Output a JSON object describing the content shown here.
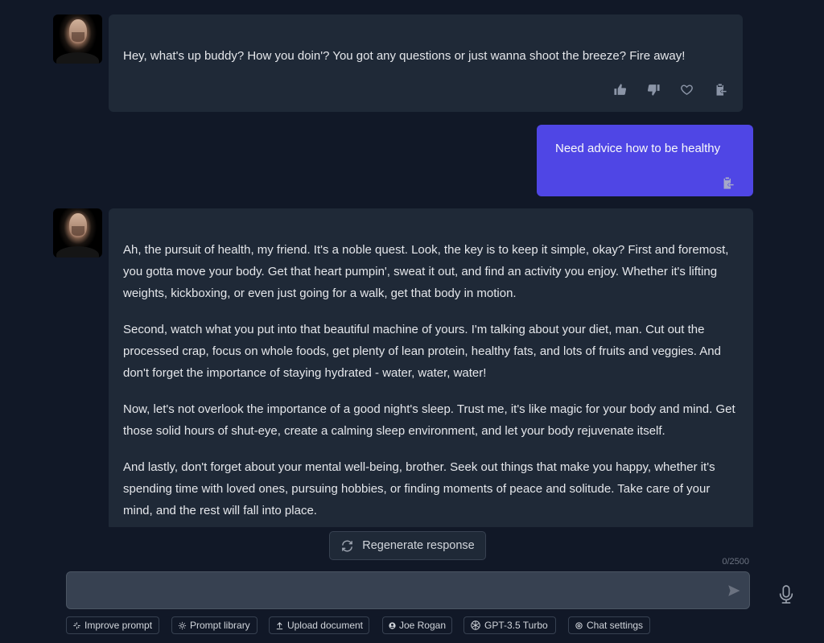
{
  "messages": [
    {
      "role": "assistant",
      "avatar": "joe-rogan-portrait",
      "paragraphs": [
        "Hey, what's up buddy? How you doin'? You got any questions or just wanna shoot the breeze? Fire away!"
      ],
      "actions": [
        "thumbs-up-icon",
        "thumbs-down-icon",
        "heart-icon",
        "copy-to-clipboard-icon"
      ]
    },
    {
      "role": "user",
      "paragraphs": [
        "Need advice how to be healthy"
      ],
      "actions": [
        "copy-to-clipboard-icon"
      ]
    },
    {
      "role": "assistant",
      "avatar": "joe-rogan-portrait",
      "paragraphs": [
        "Ah, the pursuit of health, my friend. It's a noble quest. Look, the key is to keep it simple, okay? First and foremost, you gotta move your body. Get that heart pumpin', sweat it out, and find an activity you enjoy. Whether it's lifting weights, kickboxing, or even just going for a walk, get that body in motion.",
        "Second, watch what you put into that beautiful machine of yours. I'm talking about your diet, man. Cut out the processed crap, focus on whole foods, get plenty of lean protein, healthy fats, and lots of fruits and veggies. And don't forget the importance of staying hydrated - water, water, water!",
        "Now, let's not overlook the importance of a good night's sleep. Trust me, it's like magic for your body and mind. Get those solid hours of shut-eye, create a calming sleep environment, and let your body rejuvenate itself.",
        "And lastly, don't forget about your mental well-being, brother. Seek out things that make you happy, whether it's spending time with loved ones, pursuing hobbies, or finding moments of peace and solitude. Take care of your mind, and the rest will fall into place."
      ]
    }
  ],
  "regenerate_label": "Regenerate response",
  "composer": {
    "value": "",
    "placeholder": "",
    "char_counter": "0/2500"
  },
  "toolbar": [
    {
      "icon": "sparkle-icon",
      "label": "Improve prompt"
    },
    {
      "icon": "sun-icon",
      "label": "Prompt library"
    },
    {
      "icon": "upload-icon",
      "label": "Upload document"
    },
    {
      "icon": "user-circle-icon",
      "label": "Joe Rogan"
    },
    {
      "icon": "openai-logo-icon",
      "label": "GPT-3.5 Turbo"
    },
    {
      "icon": "gear-icon",
      "label": "Chat settings"
    }
  ],
  "colors": {
    "background": "#111827",
    "assistant_bubble": "#1f2937",
    "user_bubble": "#4f46e5",
    "input": "#374151",
    "icon_muted": "#9ca3af"
  }
}
